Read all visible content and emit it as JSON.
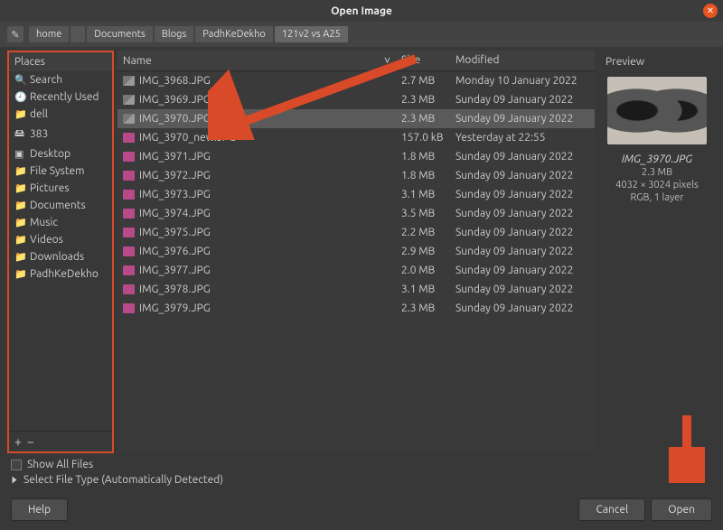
{
  "window": {
    "title": "Open Image"
  },
  "breadcrumb": [
    "home",
    "",
    "Documents",
    "Blogs",
    "PadhKeDekho",
    "121v2 vs A25"
  ],
  "places": {
    "header": "Places",
    "items": [
      {
        "icon": "🔍",
        "label": "Search"
      },
      {
        "icon": "🕘",
        "label": "Recently Used"
      },
      {
        "icon": "📁",
        "label": "dell"
      },
      {
        "icon": "🖴",
        "label": "383"
      },
      {
        "icon": "▣",
        "label": "Desktop"
      },
      {
        "icon": "📁",
        "label": "File System"
      },
      {
        "icon": "📁",
        "label": "Pictures"
      },
      {
        "icon": "📁",
        "label": "Documents"
      },
      {
        "icon": "📁",
        "label": "Music"
      },
      {
        "icon": "📁",
        "label": "Videos"
      },
      {
        "icon": "📁",
        "label": "Downloads"
      },
      {
        "icon": "📁",
        "label": "PadhKeDekho"
      }
    ]
  },
  "columns": {
    "name": "Name",
    "size": "Size",
    "modified": "Modified"
  },
  "files": [
    {
      "icon": "jpg",
      "name": "IMG_3968.JPG",
      "size": "2.7 MB",
      "modified": "Monday 10 January 2022",
      "selected": false
    },
    {
      "icon": "jpg",
      "name": "IMG_3969.JPG",
      "size": "2.3 MB",
      "modified": "Sunday 09 January 2022",
      "selected": false
    },
    {
      "icon": "jpg",
      "name": "IMG_3970.JPG",
      "size": "2.3 MB",
      "modified": "Sunday 09 January 2022",
      "selected": true
    },
    {
      "icon": "png",
      "name": "IMG_3970_new.JPG",
      "size": "157.0 kB",
      "modified": "Yesterday at 22:55",
      "selected": false
    },
    {
      "icon": "png",
      "name": "IMG_3971.JPG",
      "size": "1.8 MB",
      "modified": "Sunday 09 January 2022",
      "selected": false
    },
    {
      "icon": "png",
      "name": "IMG_3972.JPG",
      "size": "1.8 MB",
      "modified": "Sunday 09 January 2022",
      "selected": false
    },
    {
      "icon": "png",
      "name": "IMG_3973.JPG",
      "size": "3.1 MB",
      "modified": "Sunday 09 January 2022",
      "selected": false
    },
    {
      "icon": "png",
      "name": "IMG_3974.JPG",
      "size": "3.5 MB",
      "modified": "Sunday 09 January 2022",
      "selected": false
    },
    {
      "icon": "png",
      "name": "IMG_3975.JPG",
      "size": "2.2 MB",
      "modified": "Sunday 09 January 2022",
      "selected": false
    },
    {
      "icon": "png",
      "name": "IMG_3976.JPG",
      "size": "2.9 MB",
      "modified": "Sunday 09 January 2022",
      "selected": false
    },
    {
      "icon": "png",
      "name": "IMG_3977.JPG",
      "size": "2.0 MB",
      "modified": "Sunday 09 January 2022",
      "selected": false
    },
    {
      "icon": "png",
      "name": "IMG_3978.JPG",
      "size": "3.1 MB",
      "modified": "Sunday 09 January 2022",
      "selected": false
    },
    {
      "icon": "png",
      "name": "IMG_3979.JPG",
      "size": "2.3 MB",
      "modified": "Sunday 09 January 2022",
      "selected": false
    }
  ],
  "preview": {
    "header": "Preview",
    "name": "IMG_3970.JPG",
    "size": "2.3 MB",
    "dims": "4032 × 3024 pixels",
    "layers": "RGB, 1 layer"
  },
  "options": {
    "show_all": "Show All Files",
    "filetype": "Select File Type (Automatically Detected)"
  },
  "buttons": {
    "help": "Help",
    "cancel": "Cancel",
    "open": "Open"
  }
}
